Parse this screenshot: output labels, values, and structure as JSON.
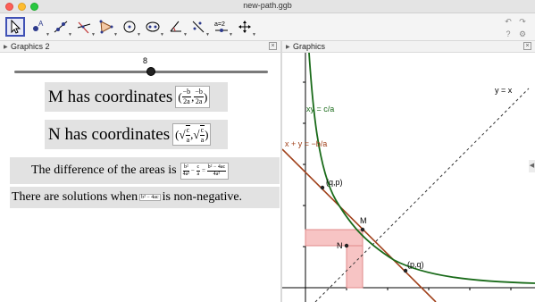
{
  "window": {
    "title": "new-path.ggb"
  },
  "panels": {
    "left_title": "Graphics 2",
    "right_title": "Graphics"
  },
  "slider": {
    "value": "8",
    "fraction": 0.54
  },
  "text": {
    "m_label": "M has coordinates",
    "m_x_num": "−b",
    "m_x_den": "2a",
    "m_y_num": "−b",
    "m_y_den": "2a",
    "n_label": "N has coordinates",
    "n_x_num": "c",
    "n_x_den": "a",
    "n_y_num": "c",
    "n_y_den": "a",
    "diff_label": "The difference of the areas is",
    "diff_f1_num": "b²",
    "diff_f1_den": "4a²",
    "diff_f2_num": "c",
    "diff_f2_den": "a",
    "diff_f3_num": "b² − 4ac",
    "diff_f3_den": "4a²",
    "sol_pre": "There are solutions when",
    "sol_expr": "b² − 4ac",
    "sol_post": "is non-negative."
  },
  "graph": {
    "labels": {
      "hyperbola": "xy = c/a",
      "line": "x + y = −b/a",
      "diagonal": "y = x",
      "qp": "(q,p)",
      "pq": "(p,q)",
      "m": "M",
      "n": "N"
    },
    "colors": {
      "hyperbola": "#1a6b1a",
      "line": "#a0401a",
      "fill": "#f5b7b7"
    }
  }
}
